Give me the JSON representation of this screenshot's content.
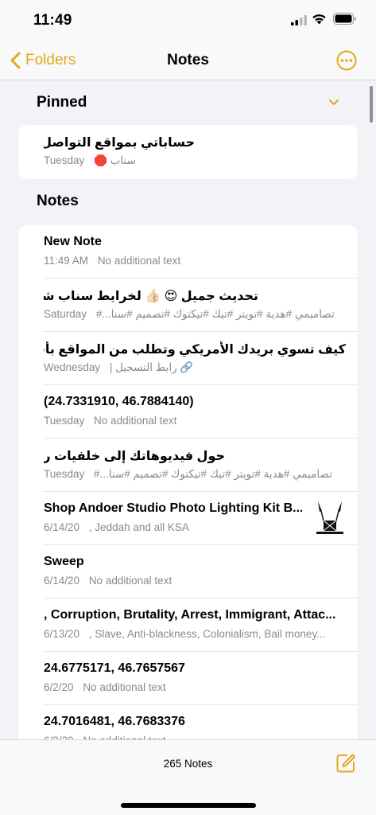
{
  "status_bar": {
    "time": "11:49"
  },
  "nav": {
    "back_label": "Folders",
    "title": "Notes"
  },
  "pinned": {
    "header": "Pinned",
    "item": {
      "title": "حساباتي بمواقع التواصل:",
      "date": "Tuesday",
      "snippet": "سناب 🛑"
    }
  },
  "notes": {
    "header": "Notes",
    "items": [
      {
        "title": "New Note",
        "date": "11:49 AM",
        "snippet": "No additional text"
      },
      {
        "title": "تحديث جميل 😍 👍🏻 لخرايط سناب شات",
        "date": "Saturday",
        "snippet": "تصاميمي #هدية #تويتر #تيك #تيكتوك #تصميم #سنا...#"
      },
      {
        "title": "كيف تسوي بريدك الأمريكي وتطلب من المواقع بأقل من...",
        "date": "Wednesday",
        "snippet": "🔗 رابط التسجيل |"
      },
      {
        "title": "(24.7331910, 46.7884140)",
        "date": "Tuesday",
        "snippet": "No additional text"
      },
      {
        "title": "حول فيديوهاتك إلى خلفيات رهيبة",
        "date": "Tuesday",
        "snippet": "تصاميمي #هدية #تويتر #تيك #تيكتوك #تصميم #سنا...#"
      },
      {
        "title": "Shop Andoer Studio Photo Lighting Kit B...",
        "date": "6/14/20",
        "snippet": ", Jeddah and all KSA"
      },
      {
        "title": "Sweep",
        "date": "6/14/20",
        "snippet": "No additional text"
      },
      {
        "title": ", Corruption, Brutality, Arrest, Immigrant, Attac...",
        "date": "6/13/20",
        "snippet": ", Slave, Anti-blackness, Colonialism, Bail money..."
      },
      {
        "title": "24.6775171, 46.7657567",
        "date": "6/2/20",
        "snippet": "No additional text"
      },
      {
        "title": "24.7016481, 46.7683376",
        "date": "6/2/20",
        "snippet": "No additional text"
      }
    ]
  },
  "toolbar": {
    "note_count": "265 Notes"
  },
  "icons": {
    "back": "chevron-left-icon",
    "more": "ellipsis-circle-icon",
    "collapse": "chevron-down-icon",
    "compose": "compose-icon",
    "link": "link-icon"
  },
  "colors": {
    "accent": "#e2a91c",
    "background": "#f2f2f7",
    "secondary_text": "#8a8a8e"
  }
}
